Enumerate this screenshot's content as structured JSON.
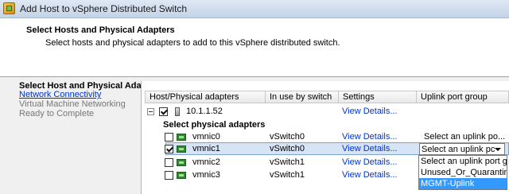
{
  "window": {
    "title": "Add Host to vSphere Distributed Switch"
  },
  "header": {
    "title": "Select Hosts and Physical Adapters",
    "description": "Select hosts and physical adapters to add to this vSphere distributed switch."
  },
  "sidebar": {
    "items": [
      {
        "label": "Select Host and Physical Ada",
        "state": "current"
      },
      {
        "label": "Network Connectivity",
        "state": "link"
      },
      {
        "label": "Virtual Machine Networking",
        "state": "disabled"
      },
      {
        "label": "Ready to Complete",
        "state": "disabled"
      }
    ]
  },
  "table": {
    "columns": [
      "Host/Physical adapters",
      "In use by switch",
      "Settings",
      "Uplink port group"
    ],
    "host": {
      "name": "10.1.1.52",
      "checked": true,
      "settings": "View Details..."
    },
    "section_label": "Select physical adapters",
    "rows": [
      {
        "name": "vmnic0",
        "checked": false,
        "in_use": "vSwitch0",
        "settings": "View Details...",
        "uplink": "Select an uplink po..."
      },
      {
        "name": "vmnic1",
        "checked": true,
        "in_use": "vSwitch0",
        "settings": "View Details...",
        "uplink": "Select an uplink pc"
      },
      {
        "name": "vmnic2",
        "checked": false,
        "in_use": "vSwitch1",
        "settings": "View Details...",
        "uplink": ""
      },
      {
        "name": "vmnic3",
        "checked": false,
        "in_use": "vSwitch1",
        "settings": "View Details...",
        "uplink": ""
      }
    ]
  },
  "dropdown": {
    "options": [
      "Select an uplink port g",
      "Unused_Or_Quarantin",
      "MGMT-Uplink"
    ],
    "highlighted": "MGMT-Uplink"
  },
  "icons": {
    "app": "vsphere-dvs-icon",
    "host": "server-icon",
    "adapter": "network-adapter-icon"
  },
  "colors": {
    "link": "#0033cc",
    "selection": "#3399ff",
    "row_highlight": "#d7e4f6"
  }
}
